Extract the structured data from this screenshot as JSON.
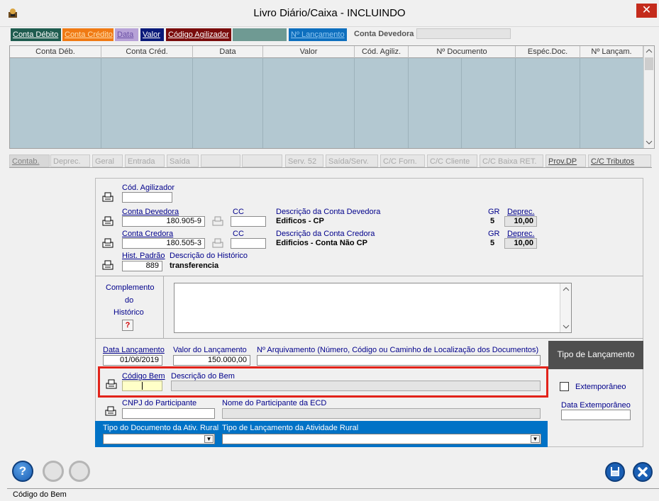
{
  "window": {
    "title": "Livro Diário/Caixa   -   INCLUINDO",
    "close_symbol": "✕"
  },
  "top_tabs": [
    {
      "label": "Conta Débito",
      "bg": "#1f5c4f",
      "fg": "#ffffff"
    },
    {
      "label": "Conta Crédito",
      "bg": "#f07a14",
      "fg": "#ffe0b0"
    },
    {
      "label": "Data",
      "bg": "#b7a2d7",
      "fg": "#6a4fa5"
    },
    {
      "label": "Valor",
      "bg": "#0a1a7a",
      "fg": "#ffffff"
    },
    {
      "label": "Código Agilizador",
      "bg": "#7a0c0c",
      "fg": "#ffffff"
    },
    {
      "label": "Nº Lançamento",
      "bg": "#0e6fbe",
      "fg": "#8fc7f2"
    }
  ],
  "conta_devedora_header_label": "Conta Devedora",
  "grid": {
    "columns": [
      "Conta Déb.",
      "Conta Créd.",
      "Data",
      "Valor",
      "Cód. Agiliz.",
      "Nº Documento",
      "Espéc.Doc.",
      "Nº Lançam."
    ]
  },
  "bottom_tabs": [
    {
      "label": "Contab.",
      "state": "active"
    },
    {
      "label": "Deprec.",
      "state": "disabled"
    },
    {
      "label": "Geral",
      "state": "disabled"
    },
    {
      "label": "Entrada",
      "state": "disabled"
    },
    {
      "label": "Saída",
      "state": "disabled"
    },
    {
      "label": "Serv. 52",
      "state": "disabled"
    },
    {
      "label": "Saída/Serv.",
      "state": "disabled"
    },
    {
      "label": "C/C Forn.",
      "state": "disabled"
    },
    {
      "label": "C/C Cliente",
      "state": "disabled"
    },
    {
      "label": "C/C Baixa RET.",
      "state": "disabled"
    },
    {
      "label": "Prov.DP",
      "state": "dark"
    },
    {
      "label": "C/C Tributos",
      "state": "dark"
    }
  ],
  "form": {
    "cod_agilizador_label": "Cód. Agilizador",
    "cod_agilizador_value": "",
    "conta_devedora_label": "Conta Devedora",
    "conta_devedora_value": "180.905-9",
    "cc_label": "CC",
    "cc_devedora_value": "",
    "desc_devedora_label": "Descrição da Conta Devedora",
    "desc_devedora_value": "Edificos - CP",
    "gr_label": "GR",
    "gr_devedora": "5",
    "deprec_label": "Deprec.",
    "deprec_devedora": "10,00",
    "conta_credora_label": "Conta Credora",
    "conta_credora_value": "180.505-3",
    "cc_credora_value": "",
    "desc_credora_label": "Descrição da Conta Credora",
    "desc_credora_value": "Edificios - Conta Não CP",
    "gr_credora": "5",
    "deprec_credora": "10,00",
    "hist_padrao_label": "Hist. Padrão",
    "hist_padrao_value": "889",
    "desc_historico_label": "Descrição do Histórico",
    "desc_historico_value": "transferencia",
    "complemento_line1": "Complemento",
    "complemento_line2": "do",
    "complemento_line3": "Histórico",
    "help_symbol": "?",
    "data_lancamento_label": "Data Lançamento",
    "data_lancamento_value": "01/06/2019",
    "valor_lancamento_label": "Valor do Lançamento",
    "valor_lancamento_value": "150.000,00",
    "arquivamento_label": "Nº Arquivamento (Número, Código ou Caminho de Localização dos Documentos)",
    "arquivamento_value": "",
    "tipo_lancamento_label": "Tipo de Lançamento",
    "codigo_bem_label": "Código Bem",
    "codigo_bem_value": "",
    "descricao_bem_label": "Descrição do Bem",
    "extemporaneo_label": "Extemporâneo",
    "extemporaneo_checked": false,
    "data_extemporaneo_label": "Data Extemporâneo",
    "cnpj_label": "CNPJ do Participante",
    "nome_participante_label": "Nome do Participante da ECD",
    "tipo_doc_rural_label": "Tipo do Documento da Ativ. Rural",
    "tipo_lanc_rural_label": "Tipo de Lançamento da Atividade Rural",
    "combo_arrow": "▼"
  },
  "bottom_buttons": {
    "help_symbol": "?",
    "save_color": "#1a5fb4",
    "close_color": "#1a5fb4"
  },
  "status_bar": {
    "text": "Código do Bem"
  }
}
